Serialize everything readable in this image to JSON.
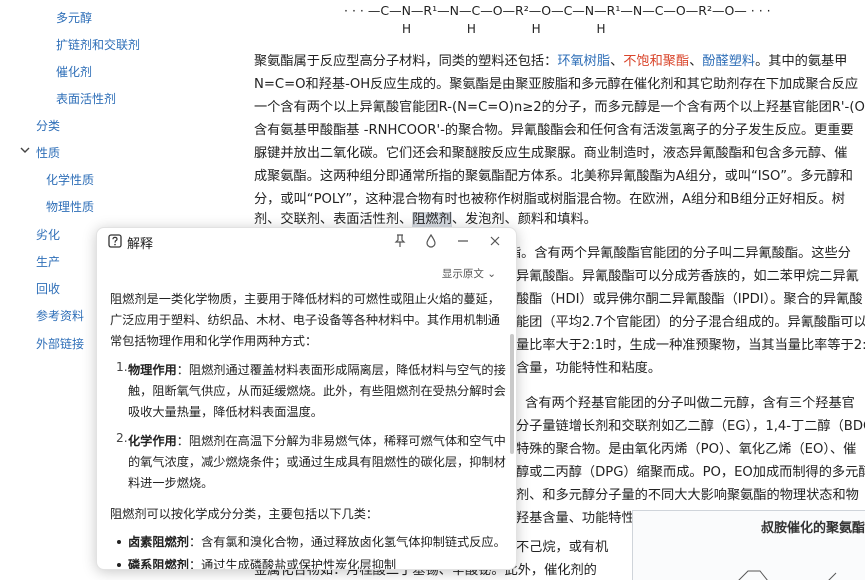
{
  "sidebar": {
    "items": [
      {
        "label": "多元醇"
      },
      {
        "label": "扩链剂和交联剂"
      },
      {
        "label": "催化剂"
      },
      {
        "label": "表面活性剂"
      },
      {
        "label": "分类"
      },
      {
        "label": "性质"
      },
      {
        "label": "化学性质"
      },
      {
        "label": "物理性质"
      },
      {
        "label": "劣化"
      },
      {
        "label": "生产"
      },
      {
        "label": "回收"
      },
      {
        "label": "参考资料"
      },
      {
        "label": "外部链接"
      }
    ]
  },
  "formula": {
    "text": "· · · —C—N—R¹—N—C—O—R²—O—C—N—R¹—N—C—O—R²—O— · · ·",
    "subs": "H H H H"
  },
  "article": {
    "l1a": "聚氨酯属于反应型高分子材料，同类的塑料还包括：",
    "l1_link1": "环氧树脂",
    "l1_sep1": "、",
    "l1_link2": "不饱和聚酯",
    "l1_sep2": "、",
    "l1_link3": "酚醛塑料",
    "l1b": "。其中的氨基甲",
    "l2": "N=C=O和羟基-OH反应生成的。聚氨酯是由聚亚胺脂和多元醇在催化剂和其它助剂存在下加成聚合反应",
    "l3": "一个含有两个以上异氰酸官能团R-(N=C=O)n≥2的分子，而多元醇是一个含有两个以上羟基官能团R'-(O",
    "l4": "含有氨基甲酸酯基 -RNHCOOR'-的聚合物。异氰酸酯会和任何含有活泼氢离子的分子发生反应。更重要",
    "l5": "脲键并放出二氧化碳。它们还会和聚醚胺反应生成聚脲。商业制造时，液态异氰酸酯和包含多元醇、催",
    "l6": "成聚氨酯。这两种组分即通常所指的聚氨酯配方体系。北美称异氰酸酯为A组分，或叫“ISO”。多元醇和",
    "l7": "分，或叫“POLY”，这种混合物有时也被称作树脂或树脂混合物。在欧洲，A组分和B组分正好相反。树",
    "l8a": "剂、交联剂、表面活性剂、",
    "l8_hl": "阻燃剂",
    "l8b": "、发泡剂、颜料和填料。",
    "r1": "酯。含有两个异氰酸酯官能团的分子叫二异氰酸酯。这些分",
    "r2": "异氰酸酯。异氰酸酯可以分成芳香族的，如二苯甲烷二异氰",
    "r3": "酸酯（HDI）或异佛尔酮二异氰酸酯（IPDI）。聚合的异氰酸",
    "r4": "能团（平均2.7个官能团）的分子混合组成的。异氰酸酯可以",
    "r5": "量比率大于2:1时，生成一种准预聚物，当其当量比率等于2:",
    "r6": "含量，功能特性和粘度。",
    "r7": "，含有两个羟基官能团的分子叫做二元醇，含有三个羟基官",
    "r8": "分子量链增长剂和交联剂如乙二醇（EG），1,4-丁二醇（BDO",
    "r9": "特殊的聚合物。是由氧化丙烯（PO）、氧化乙烯（EO）、催",
    "r10": "醇或二丙醇（DPG）缩聚而成。PO，EO加成而制得的多元醇",
    "r11": "剂、和多元醇分子量的不同大大影响聚氨酯的物理状态和物",
    "r12": "羟基含量、功能特性和粘度。",
    "r13": "不己烷，或有机",
    "r14": "金属化合物如：月桂酸二丁基锡、辛酸铋。此外，催化剂的"
  },
  "table_caption": "叔胺催化的聚氨酯",
  "popup": {
    "title": "解释",
    "show_source": "显示原文",
    "intro": [
      "阻燃剂是一类化学物质，主要用于降低材料的可燃性或阻止火焰的蔓延，",
      "广泛应用于塑料、纺织品、木材、电子设备等各种材料中。其作用机制通",
      "常包括物理作用和化学作用两种方式："
    ],
    "item1_num": "1.",
    "item1_head": "物理作用",
    "item1_lines": [
      "：阻燃剂通过覆盖材料表面形成隔离层，降低材料与空气的接",
      "触，阻断氧气供应，从而延缓燃烧。此外，有些阻燃剂在受热分解时会",
      "吸收大量热量，降低材料表面温度。"
    ],
    "item2_num": "2.",
    "item2_head": "化学作用",
    "item2_lines": [
      "：阻燃剂在高温下分解为非易燃气体，稀释可燃气体和空气中",
      "的氧气浓度，减少燃烧条件；或通过生成具有阻燃性的碳化层，抑制材",
      "料进一步燃烧。"
    ],
    "classify": "阻燃剂可以按化学成分分类，主要包括以下几类：",
    "bullet1_head": "卤素阻燃剂",
    "bullet1_text": "：含有氯和溴化合物，通过释放卤化氢气体抑制链式反应。",
    "bullet2_head": "磷系阻燃剂",
    "bullet2_text": "：通过生成磷酸盐或保护性炭化层抑制"
  },
  "colors": {
    "link": "#2f6fb8",
    "link_red": "#d9452b",
    "highlight": "#d8dde4"
  }
}
